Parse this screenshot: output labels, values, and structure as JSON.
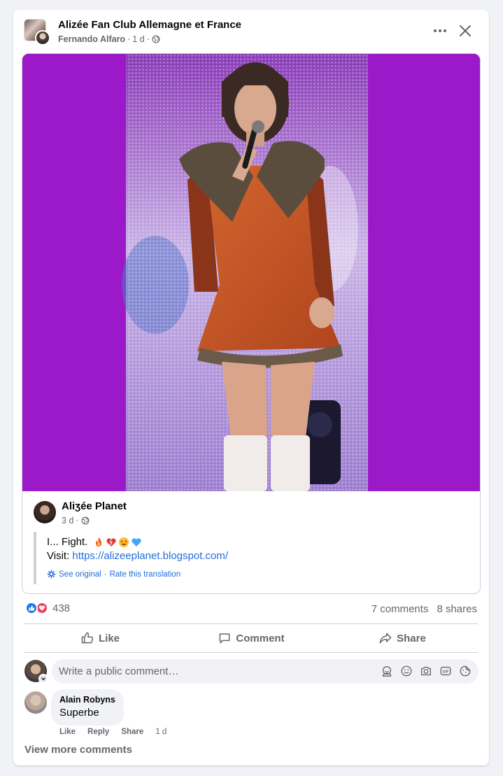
{
  "post": {
    "group_name": "Alizée Fan Club Allemagne et France",
    "author": "Fernando Alfaro",
    "time": "1 d",
    "dot": "·"
  },
  "shared": {
    "name": "Aliʒée Planet",
    "time": "3 d",
    "line1_text": "I... Fight.",
    "visit_label": "Visit:",
    "link": "https://alizeeplanet.blogspot.com/",
    "see_original": "See original",
    "rate_translation": "Rate this translation"
  },
  "stats": {
    "reaction_count": "438",
    "comments": "7 comments",
    "shares": "8 shares"
  },
  "actions": {
    "like": "Like",
    "comment": "Comment",
    "share": "Share"
  },
  "composer": {
    "placeholder": "Write a public comment…"
  },
  "comment": {
    "author": "Alain Robyns",
    "text": "Superbe",
    "like": "Like",
    "reply": "Reply",
    "share": "Share",
    "time": "1 d"
  },
  "view_more": "View more comments",
  "colors": {
    "photo_background": "#9b19c9",
    "link": "#216fdb",
    "like_blue": "#1877f2",
    "love_red": "#f33e58",
    "secondary_text": "#65676b"
  },
  "icons": [
    "globe-icon",
    "more-icon",
    "close-icon",
    "like-icon",
    "comment-icon",
    "share-icon",
    "sticker-icon",
    "emoji-icon",
    "camera-icon",
    "gif-icon",
    "avatar-sticker-icon",
    "fire-emoji",
    "heart-emoji",
    "star-eyes-emoji",
    "blue-heart-emoji"
  ]
}
